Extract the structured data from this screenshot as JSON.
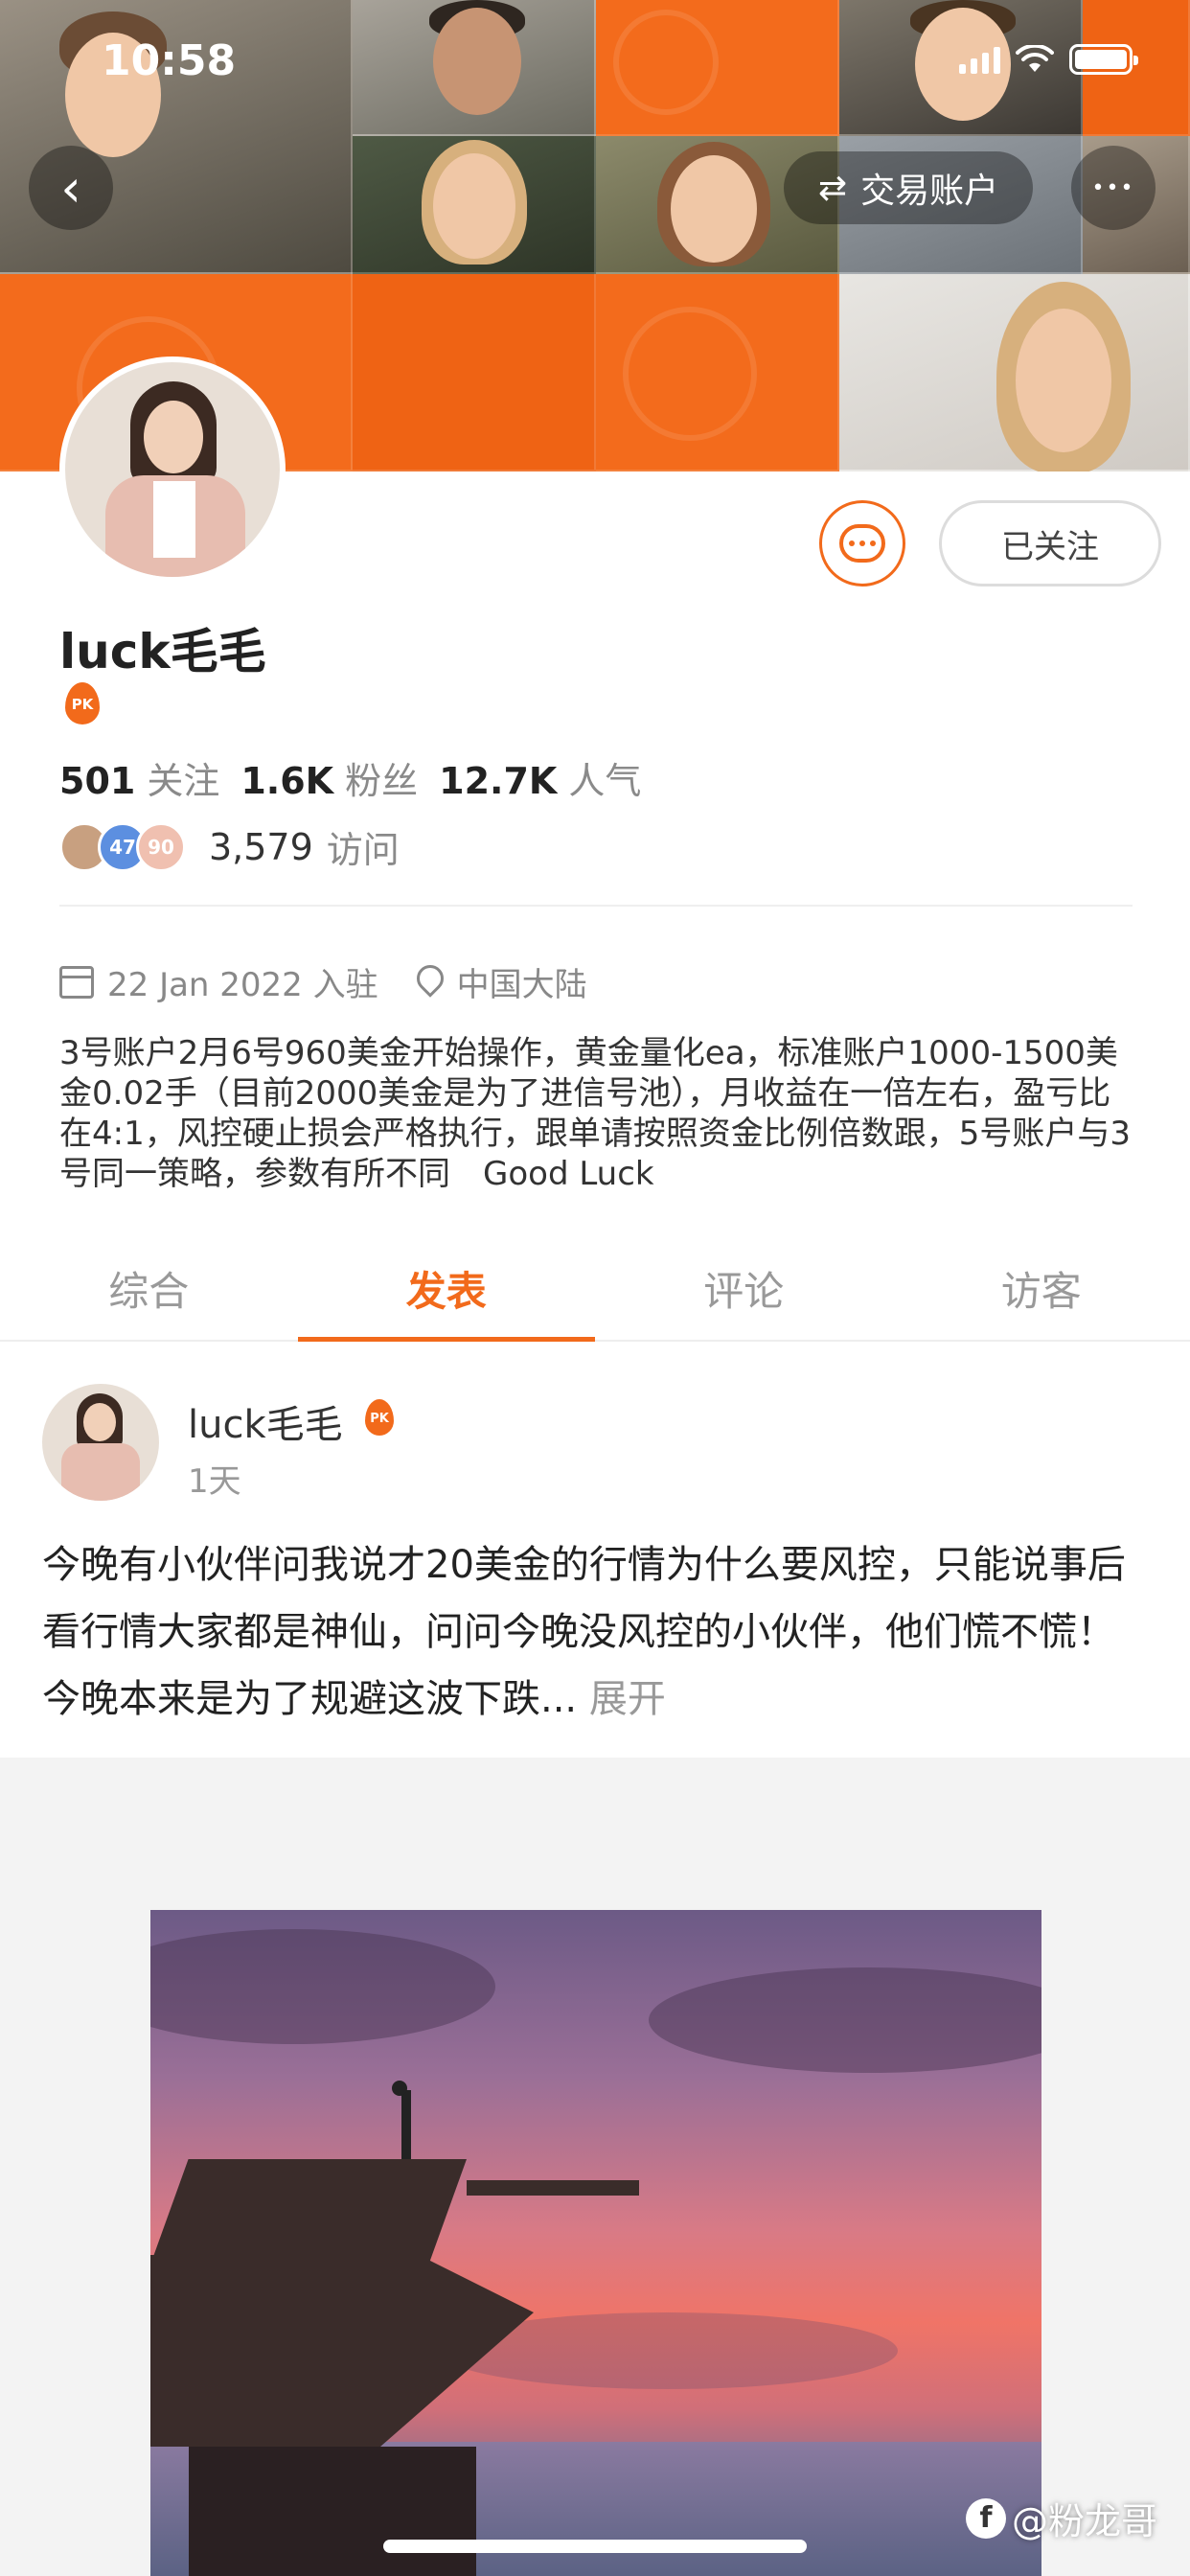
{
  "status_bar": {
    "time": "10:58"
  },
  "header": {
    "trade_account_label": "交易账户",
    "back_glyph": "‹",
    "more_glyph": "•••",
    "swap_glyph": "⇄"
  },
  "profile": {
    "name": "luck毛毛",
    "pk_badge": "PK",
    "follow_button": "已关注",
    "stats": [
      {
        "value": "501",
        "label": "关注"
      },
      {
        "value": "1.6K",
        "label": "粉丝"
      },
      {
        "value": "12.7K",
        "label": "人气"
      }
    ],
    "visitor_badges": [
      "",
      "47",
      "90"
    ],
    "visit_count": "3,579",
    "visit_label": "访问",
    "joined": "22 Jan 2022 入驻",
    "location": "中国大陆",
    "bio": "3号账户2月6号960美金开始操作，黄金量化ea，标准账户1000-1500美金0.02手（目前2000美金是为了进信号池），月收益在一倍左右，盈亏比在4:1，风控硬止损会严格执行，跟单请按照资金比例倍数跟，5号账户与3号同一策略，参数有所不同　Good Luck"
  },
  "tabs": [
    "综合",
    "发表",
    "评论",
    "访客"
  ],
  "active_tab": 1,
  "post": {
    "author": "luck毛毛",
    "pk_badge": "PK",
    "time": "1天",
    "text": "今晚有小伙伴问我说才20美金的行情为什么要风控，只能说事后看行情大家都是神仙，问问今晚没风控的小伙伴，他们慌不慌！今晚本来是为了规避这波下跌...",
    "expand": " 展开"
  },
  "watermark": {
    "icon": "f",
    "text": "@粉龙哥"
  },
  "colors": {
    "accent": "#f26a1b"
  }
}
